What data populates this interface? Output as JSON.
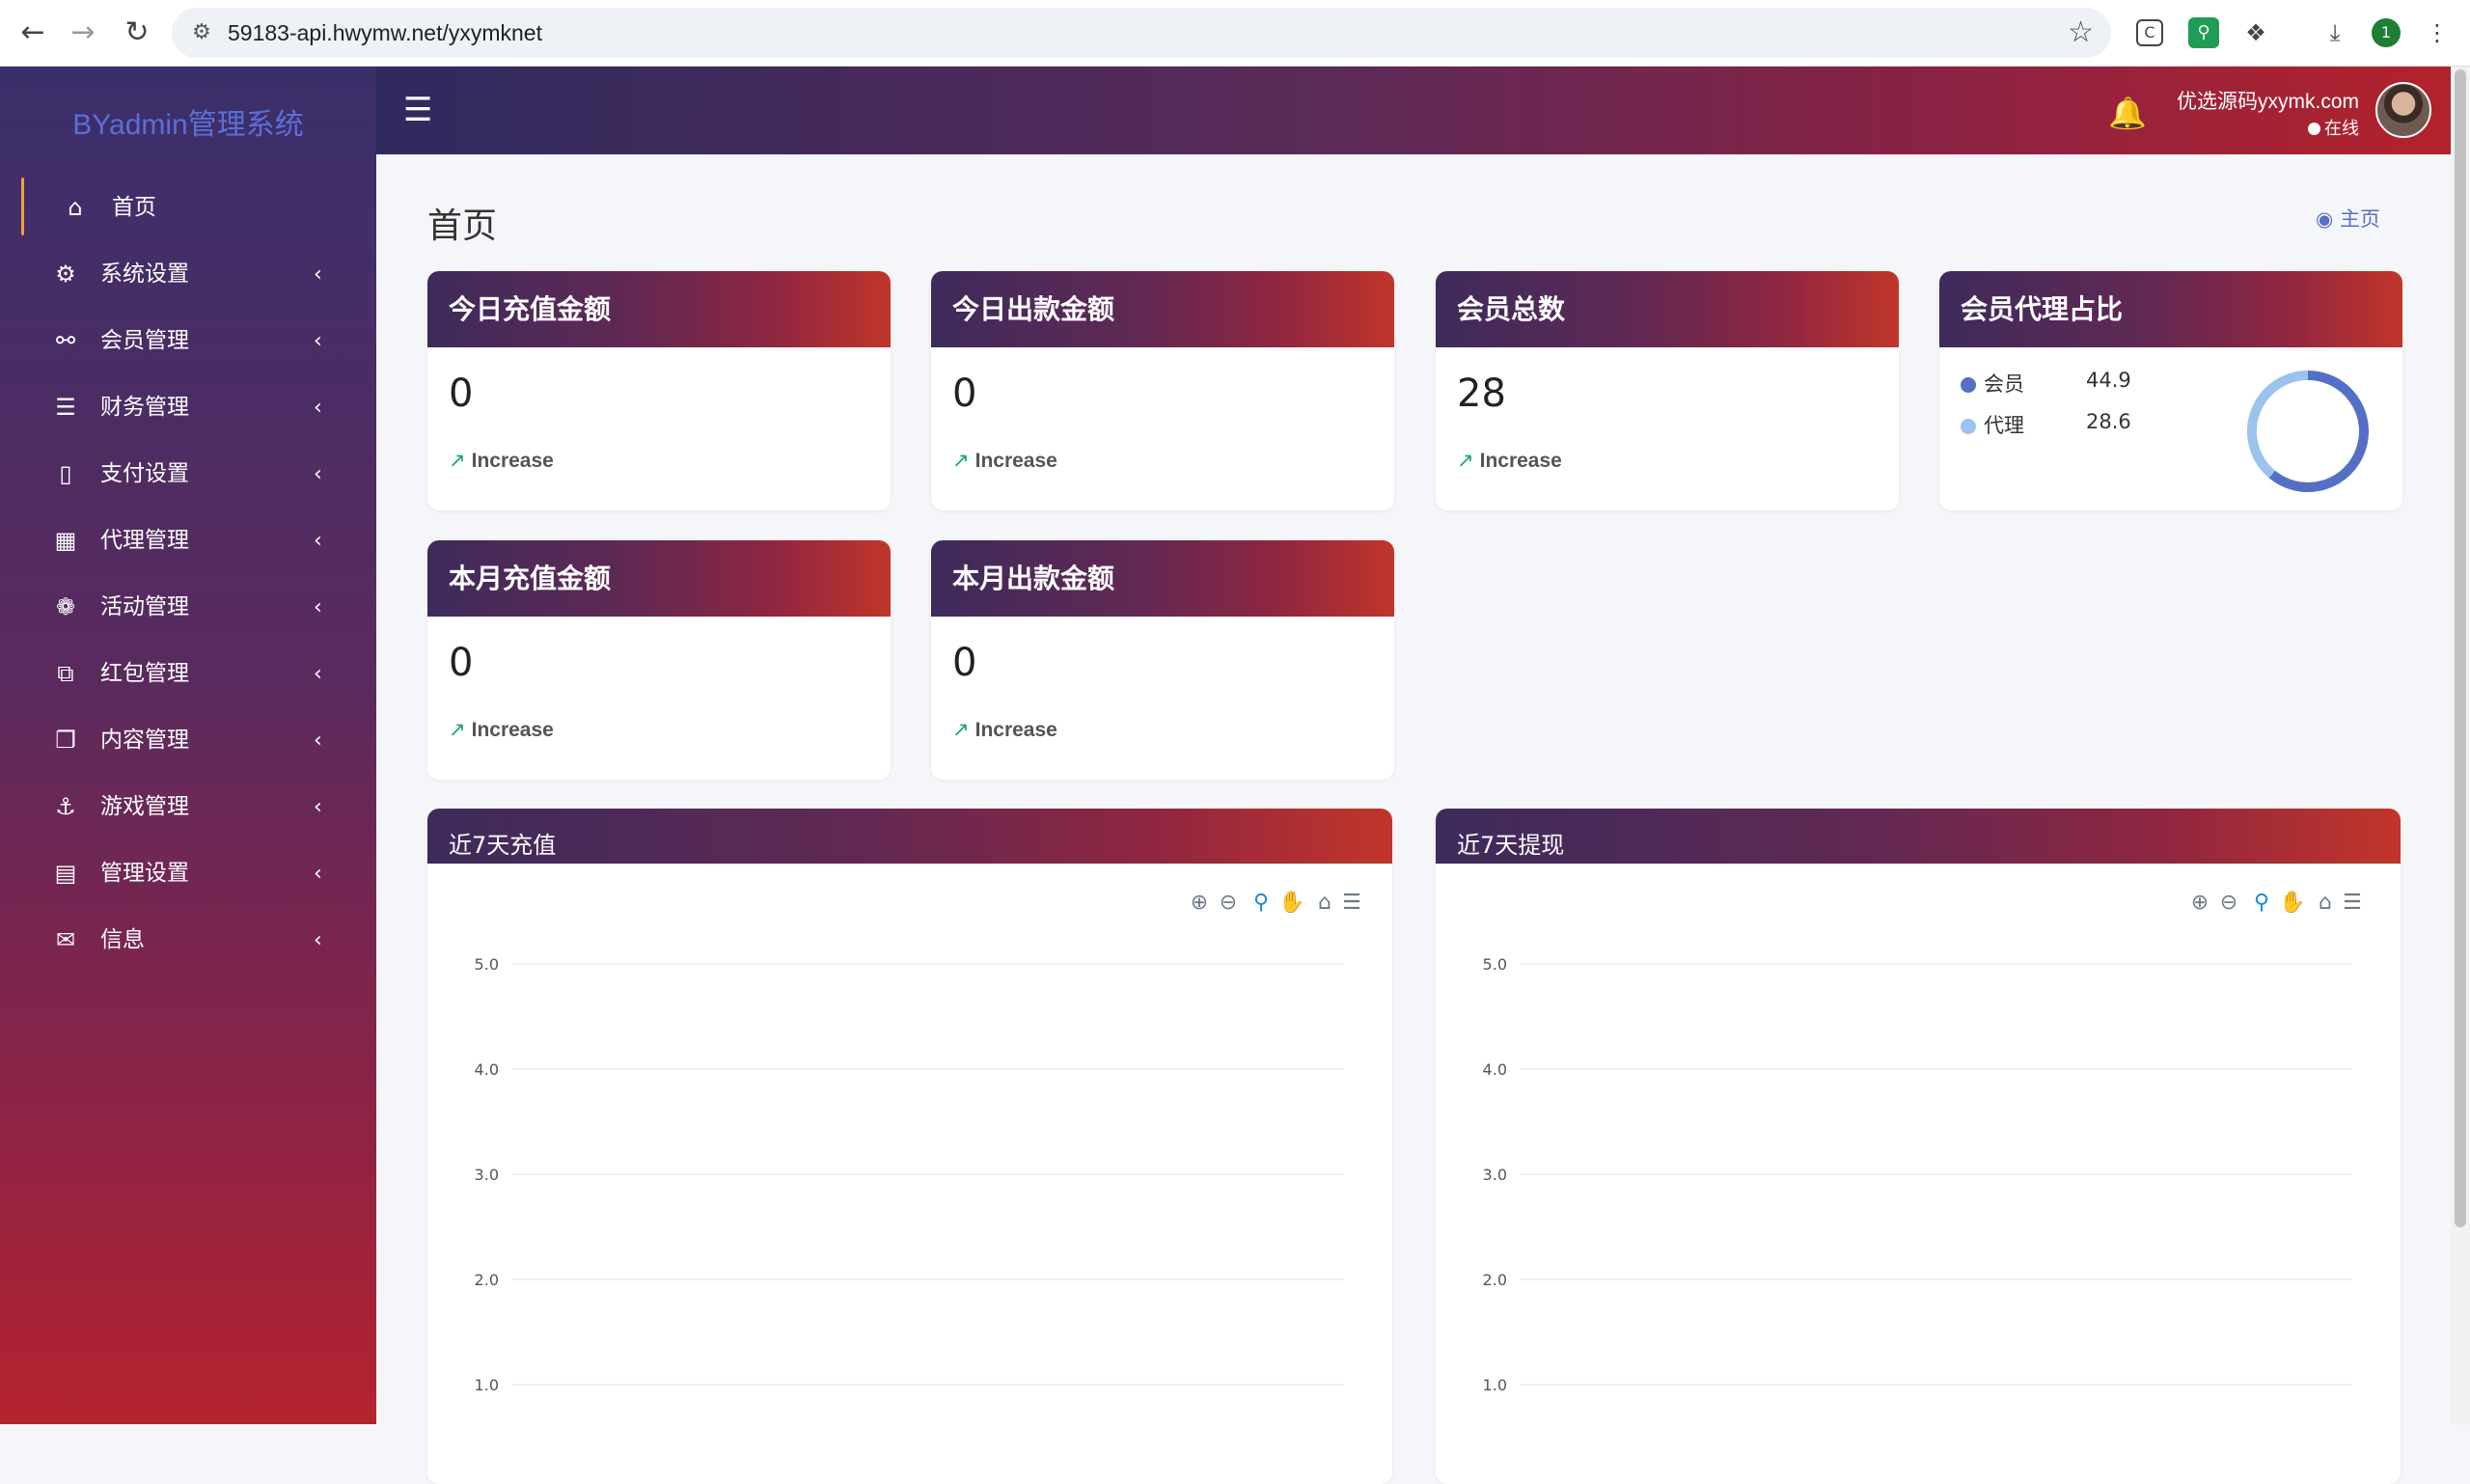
{
  "browser": {
    "url": "59183-api.hwymw.net/yxymknet",
    "profile_badge": "1"
  },
  "sidebar": {
    "brand": "BYadmin管理系统",
    "items": [
      {
        "label": "首页",
        "icon": "home-icon",
        "active": true
      },
      {
        "label": "系统设置",
        "icon": "gears-icon"
      },
      {
        "label": "会员管理",
        "icon": "user-icon"
      },
      {
        "label": "财务管理",
        "icon": "database-icon"
      },
      {
        "label": "支付设置",
        "icon": "bookmark-icon"
      },
      {
        "label": "代理管理",
        "icon": "address-book-icon"
      },
      {
        "label": "活动管理",
        "icon": "yelp-icon"
      },
      {
        "label": "红包管理",
        "icon": "clone-icon"
      },
      {
        "label": "内容管理",
        "icon": "copy-icon"
      },
      {
        "label": "游戏管理",
        "icon": "anchor-icon"
      },
      {
        "label": "管理设置",
        "icon": "id-card-icon"
      },
      {
        "label": "信息",
        "icon": "comments-icon"
      }
    ]
  },
  "header": {
    "user_name": "优选源码yxymk.com",
    "user_status": "在线"
  },
  "main": {
    "page_title": "首页",
    "breadcrumb": "主页",
    "stats": [
      {
        "title": "今日充值金额",
        "value": "0",
        "trend": "Increase"
      },
      {
        "title": "今日出款金额",
        "value": "0",
        "trend": "Increase"
      },
      {
        "title": "会员总数",
        "value": "28",
        "trend": "Increase"
      },
      {
        "title": "本月充值金额",
        "value": "0",
        "trend": "Increase"
      },
      {
        "title": "本月出款金额",
        "value": "0",
        "trend": "Increase"
      }
    ],
    "ratio_card": {
      "title": "会员代理占比",
      "legend": [
        {
          "label": "会员",
          "value": "44.9",
          "color": "#5470c6"
        },
        {
          "label": "代理",
          "value": "28.6",
          "color": "#9ac4ef"
        }
      ]
    }
  },
  "chart_data": [
    {
      "type": "donut",
      "title": "会员代理占比",
      "categories": [
        "会员",
        "代理"
      ],
      "values": [
        44.9,
        28.6
      ],
      "colors": [
        "#5470c6",
        "#9ac4ef"
      ]
    },
    {
      "type": "line",
      "title": "近7天充值",
      "ylim": [
        0,
        5
      ],
      "yticks": [
        "5.0",
        "4.0",
        "3.0",
        "2.0",
        "1.0"
      ],
      "series": [],
      "grid": true
    },
    {
      "type": "line",
      "title": "近7天提现",
      "ylim": [
        0,
        5
      ],
      "yticks": [
        "5.0",
        "4.0",
        "3.0",
        "2.0",
        "1.0"
      ],
      "series": [],
      "grid": true
    }
  ]
}
